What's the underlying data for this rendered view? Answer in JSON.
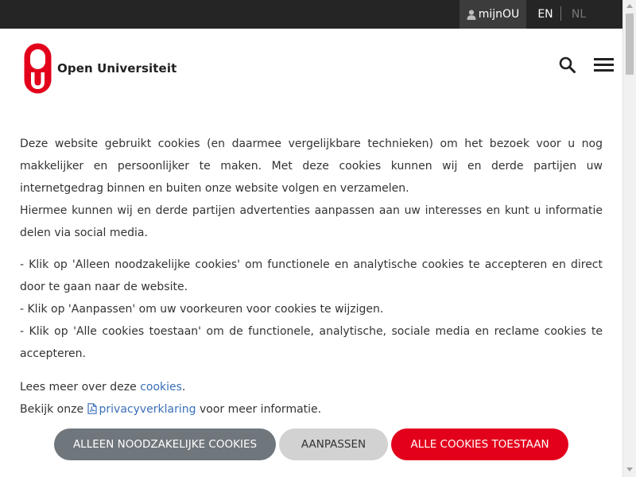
{
  "topbar": {
    "account_label": "mijnOU",
    "lang_en": "EN",
    "lang_nl": "NL"
  },
  "header": {
    "logo_text": "Open Universiteit",
    "logo_letters": "OU"
  },
  "icons": {
    "user": "user-icon",
    "search": "search-icon",
    "menu": "hamburger-menu-icon",
    "pdf": "pdf-file-icon"
  },
  "colors": {
    "brand_red": "#e3001b",
    "topbar_bg": "#252525",
    "link": "#3a6fb8",
    "btn_gray": "#6f767c",
    "btn_light": "#d2d2d2"
  },
  "cookie_notice": {
    "intro_1": "Deze website gebruikt cookies (en daarmee vergelijkbare technieken) om het bezoek voor u nog makkelijker en persoonlijker te maken. Met deze cookies kunnen wij en derde partijen uw internetgedrag binnen en buiten onze website volgen en verzamelen.",
    "intro_2": "Hiermee kunnen wij en derde partijen advertenties aanpassen aan uw interesses en kunt u informatie delen via social media.",
    "option_1": "- Klik op 'Alleen noodzakelijke cookies' om functionele en analytische cookies te accepteren en direct door te gaan naar de website.",
    "option_2": "- Klik op 'Aanpassen' om uw voorkeuren voor cookies te wijzigen.",
    "option_3": "- Klik op 'Alle cookies toestaan' om de functionele, analytische, sociale media en reclame cookies te accepteren.",
    "read_more_prefix": "Lees meer over deze ",
    "read_more_link": "cookies",
    "read_more_suffix": ".",
    "privacy_prefix": "Bekijk onze ",
    "privacy_link": "privacyverklaring",
    "privacy_suffix": " voor meer informatie."
  },
  "buttons": {
    "necessary": "ALLEEN NOODZAKELIJKE COOKIES",
    "customize": "AANPASSEN",
    "accept_all": "ALLE COOKIES TOESTAAN"
  }
}
